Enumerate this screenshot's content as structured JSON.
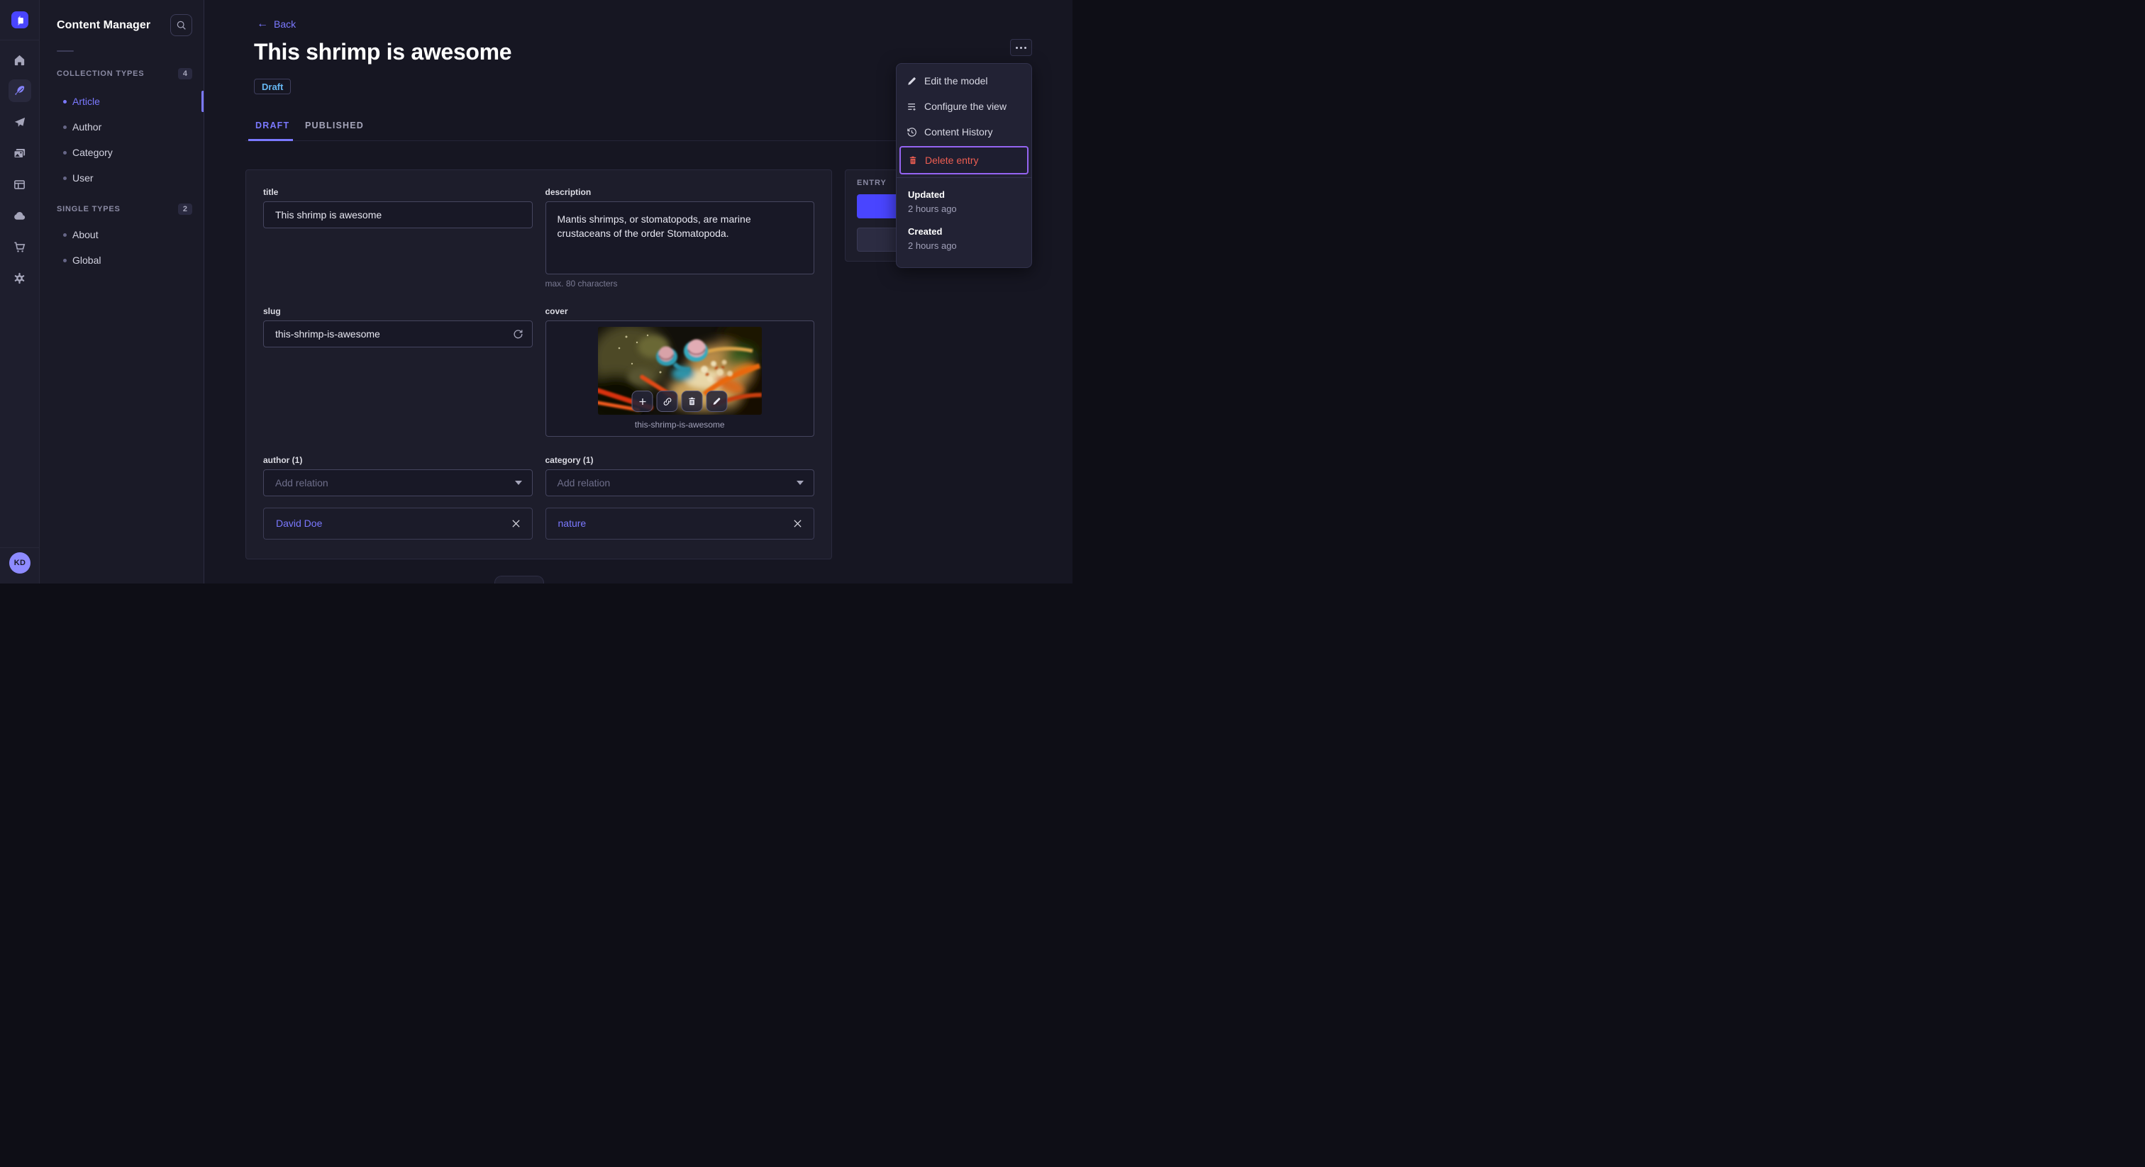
{
  "iconbar": {
    "avatar_initials": "KD",
    "icons": [
      "home-icon",
      "feather-icon",
      "send-icon",
      "media-icon",
      "layout-icon",
      "cloud-icon",
      "cart-icon",
      "gear-icon"
    ]
  },
  "sidebar": {
    "title": "Content Manager",
    "collection_types": {
      "label": "COLLECTION TYPES",
      "count": "4",
      "items": [
        {
          "label": "Article",
          "active": true
        },
        {
          "label": "Author",
          "active": false
        },
        {
          "label": "Category",
          "active": false
        },
        {
          "label": "User",
          "active": false
        }
      ]
    },
    "single_types": {
      "label": "SINGLE TYPES",
      "count": "2",
      "items": [
        {
          "label": "About",
          "active": false
        },
        {
          "label": "Global",
          "active": false
        }
      ]
    }
  },
  "header": {
    "back_arrow": "←",
    "back_label": "Back",
    "title": "This shrimp is awesome",
    "status": "Draft"
  },
  "tabs": {
    "draft": "DRAFT",
    "published": "PUBLISHED"
  },
  "form": {
    "title": {
      "label": "title",
      "value": "This shrimp is awesome"
    },
    "description": {
      "label": "description",
      "value": "Mantis shrimps, or stomatopods, are marine crustaceans of the order Stomatopoda.",
      "hint": "max. 80 characters"
    },
    "slug": {
      "label": "slug",
      "value": "this-shrimp-is-awesome"
    },
    "cover": {
      "label": "cover",
      "caption": "this-shrimp-is-awesome"
    },
    "author": {
      "label": "author (1)",
      "placeholder": "Add relation",
      "relation": "David Doe"
    },
    "category": {
      "label": "category (1)",
      "placeholder": "Add relation",
      "relation": "nature"
    }
  },
  "entry_panel": {
    "title": "ENTRY"
  },
  "menu": {
    "items": [
      {
        "label": "Edit the model"
      },
      {
        "label": "Configure the view"
      },
      {
        "label": "Content History"
      },
      {
        "label": "Delete entry"
      }
    ],
    "meta": {
      "updated_label": "Updated",
      "updated_value": "2 hours ago",
      "created_label": "Created",
      "created_value": "2 hours ago"
    }
  },
  "colors": {
    "primary": "#4945ff",
    "link": "#7b79ff",
    "danger": "#ee5e52",
    "draft_status": "#66b7f1",
    "focus_outline": "#9564f2"
  }
}
